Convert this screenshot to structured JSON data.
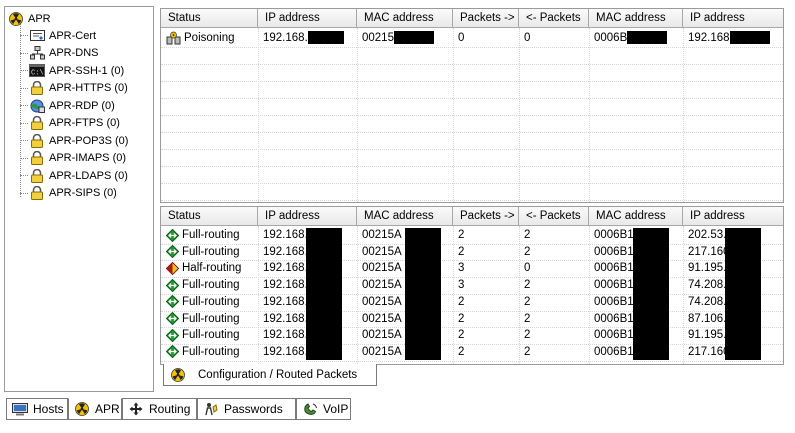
{
  "tree": {
    "root": "APR",
    "items": [
      {
        "label": "APR-Cert",
        "icon": "certificate-icon"
      },
      {
        "label": "APR-DNS",
        "icon": "network-icon"
      },
      {
        "label": "APR-SSH-1 (0)",
        "icon": "terminal-icon"
      },
      {
        "label": "APR-HTTPS (0)",
        "icon": "lock-icon"
      },
      {
        "label": "APR-RDP (0)",
        "icon": "remote-desktop-icon"
      },
      {
        "label": "APR-FTPS (0)",
        "icon": "lock-icon"
      },
      {
        "label": "APR-POP3S (0)",
        "icon": "lock-icon"
      },
      {
        "label": "APR-IMAPS (0)",
        "icon": "lock-icon"
      },
      {
        "label": "APR-LDAPS (0)",
        "icon": "lock-icon"
      },
      {
        "label": "APR-SIPS (0)",
        "icon": "lock-icon"
      }
    ]
  },
  "columns": [
    "Status",
    "IP address",
    "MAC address",
    "Packets ->",
    "<- Packets",
    "MAC address",
    "IP address"
  ],
  "top_table": {
    "rows": [
      {
        "status": "Poisoning",
        "status_icon": "poisoning-icon",
        "ip1": "192.168.",
        "mac1": "00215",
        "pkt_out": "0",
        "pkt_in": "0",
        "mac2": "0006B",
        "ip2": "192.168"
      }
    ]
  },
  "bottom_table": {
    "rows": [
      {
        "status": "Full-routing",
        "status_icon": "full-routing-icon",
        "ip1": "192.168.",
        "mac1": "00215A",
        "pkt_out": "2",
        "pkt_in": "2",
        "mac2": "0006B13",
        "ip2": "202.53."
      },
      {
        "status": "Full-routing",
        "status_icon": "full-routing-icon",
        "ip1": "192.168.",
        "mac1": "00215A",
        "pkt_out": "2",
        "pkt_in": "2",
        "mac2": "0006B13",
        "ip2": "217.160"
      },
      {
        "status": "Half-routing",
        "status_icon": "half-routing-icon",
        "ip1": "192.168.",
        "mac1": "00215A",
        "pkt_out": "3",
        "pkt_in": "0",
        "mac2": "0006B13",
        "ip2": "91.195."
      },
      {
        "status": "Full-routing",
        "status_icon": "full-routing-icon",
        "ip1": "192.168.",
        "mac1": "00215A",
        "pkt_out": "3",
        "pkt_in": "2",
        "mac2": "0006B13",
        "ip2": "74.208."
      },
      {
        "status": "Full-routing",
        "status_icon": "full-routing-icon",
        "ip1": "192.168.",
        "mac1": "00215A",
        "pkt_out": "2",
        "pkt_in": "2",
        "mac2": "0006B13",
        "ip2": "74.208."
      },
      {
        "status": "Full-routing",
        "status_icon": "full-routing-icon",
        "ip1": "192.168.",
        "mac1": "00215A",
        "pkt_out": "2",
        "pkt_in": "2",
        "mac2": "0006B13",
        "ip2": "87.106."
      },
      {
        "status": "Full-routing",
        "status_icon": "full-routing-icon",
        "ip1": "192.168.",
        "mac1": "00215A",
        "pkt_out": "2",
        "pkt_in": "2",
        "mac2": "0006B13",
        "ip2": "91.195."
      },
      {
        "status": "Full-routing",
        "status_icon": "full-routing-icon",
        "ip1": "192.168.",
        "mac1": "00215A",
        "pkt_out": "2",
        "pkt_in": "2",
        "mac2": "0006B13",
        "ip2": "217.160"
      }
    ]
  },
  "subtab": {
    "label": "Configuration / Routed Packets",
    "icon": "radiation-icon"
  },
  "bottom_tabs": [
    {
      "label": "Hosts",
      "icon": "hosts-icon"
    },
    {
      "label": "APR",
      "icon": "radiation-icon",
      "active": true
    },
    {
      "label": "Routing",
      "icon": "routing-icon"
    },
    {
      "label": "Passwords",
      "icon": "passwords-icon"
    },
    {
      "label": "VoIP",
      "icon": "voip-icon"
    }
  ],
  "colors": {
    "full_routing": "#1f9a2e",
    "half_routing": "#b01818",
    "radiation": "#f2c200"
  }
}
